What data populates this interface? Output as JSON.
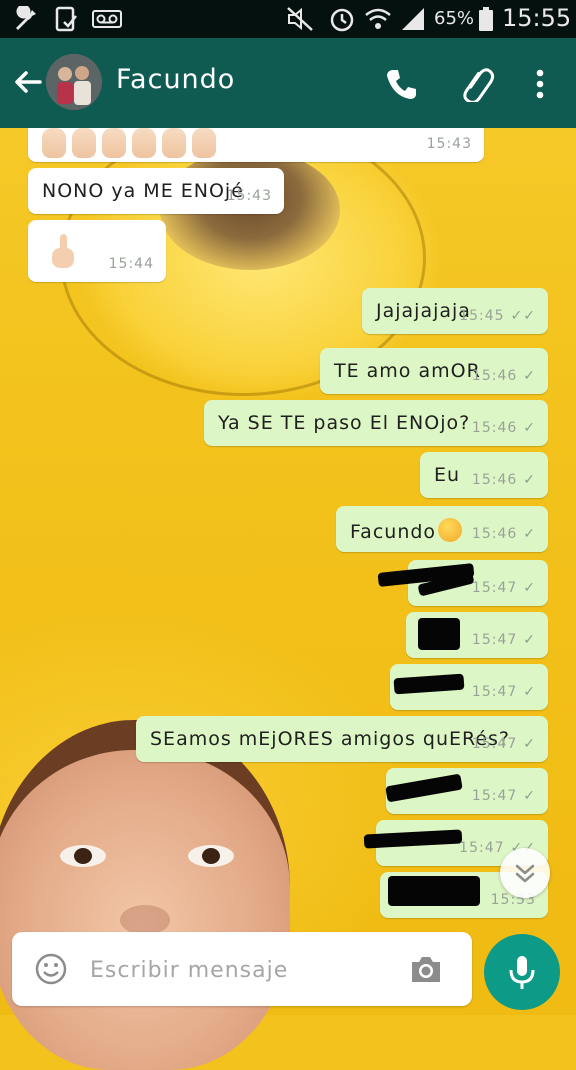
{
  "status_bar": {
    "battery_percent": "65%",
    "time": "15:55",
    "icons": [
      "wrench-icon",
      "phone-check-icon",
      "voicemail-icon",
      "mute-icon",
      "alarm-icon",
      "wifi-icon",
      "signal-icon",
      "battery-icon"
    ]
  },
  "chat_header": {
    "contact_name": "Facundo",
    "icons": [
      "back-arrow-icon",
      "avatar",
      "phone-icon",
      "paperclip-icon",
      "more-vert-icon"
    ]
  },
  "messages": [
    {
      "direction": "in",
      "text": "",
      "time": "15:43"
    },
    {
      "direction": "in",
      "text": "NONO ya ME ENOjé",
      "time": "15:43"
    },
    {
      "direction": "in",
      "text": "",
      "time": "15:44"
    },
    {
      "direction": "out",
      "text": "Jajajajaja",
      "time": "15:45",
      "status": "read"
    },
    {
      "direction": "out",
      "text": "TE amo amOR",
      "time": "15:46",
      "status": "sent"
    },
    {
      "direction": "out",
      "text": "Ya SE TE paso El ENOjo?",
      "time": "15:46",
      "status": "sent"
    },
    {
      "direction": "out",
      "text": "Eu",
      "time": "15:46",
      "status": "sent"
    },
    {
      "direction": "out",
      "text": "Facundo",
      "time": "15:46",
      "status": "sent"
    },
    {
      "direction": "out",
      "text": "",
      "time": "15:47",
      "status": "sent"
    },
    {
      "direction": "out",
      "text": "",
      "time": "15:47",
      "status": "sent"
    },
    {
      "direction": "out",
      "text": "",
      "time": "15:47",
      "status": "sent"
    },
    {
      "direction": "out",
      "text": "SEamos mEjORES amigos quERés?",
      "time": "15:47",
      "status": "sent"
    },
    {
      "direction": "out",
      "text": "",
      "time": "15:47",
      "status": "sent"
    },
    {
      "direction": "out",
      "text": "",
      "time": "15:47",
      "status": "read"
    },
    {
      "direction": "out",
      "text": "",
      "time": "15:53",
      "status": "sent"
    }
  ],
  "composer": {
    "placeholder": "Escribir mensaje"
  },
  "colors": {
    "header": "#0f5b52",
    "status_bar": "#05110f",
    "outgoing_bubble": "#ddf6c5",
    "incoming_bubble": "#ffffff",
    "mic_button": "#0d9a86",
    "wallpaper": "#f3c21c"
  }
}
